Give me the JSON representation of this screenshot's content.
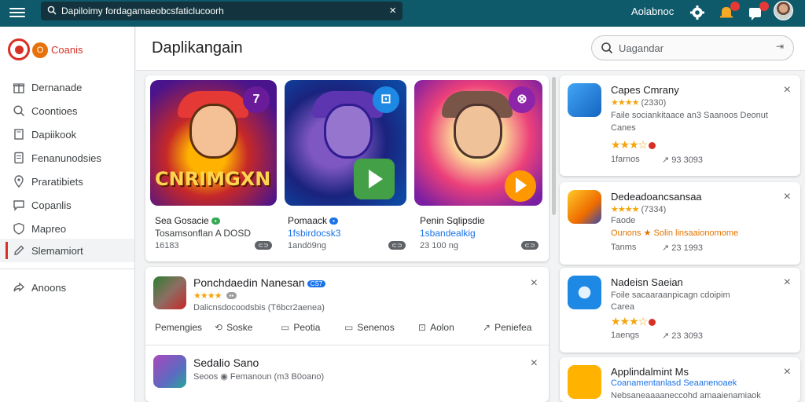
{
  "topbar": {
    "url": "Dapiloimy fordagamaeobcsfaticlucoorh",
    "user_name": "Aolabnoc"
  },
  "sidebar": {
    "brand": "Coanis",
    "brand_logo_glyph": "O",
    "items": [
      {
        "label": "Dernanade",
        "icon": "gift-icon"
      },
      {
        "label": "Coontioes",
        "icon": "search-icon"
      },
      {
        "label": "Dapiikook",
        "icon": "book-icon"
      },
      {
        "label": "Fenanunodsies",
        "icon": "document-icon"
      },
      {
        "label": "Praratibiets",
        "icon": "location-pin-icon"
      },
      {
        "label": "Copanlis",
        "icon": "chat-icon"
      },
      {
        "label": "Mapreo",
        "icon": "shield-icon"
      },
      {
        "label": "Slemamiort",
        "icon": "edit-icon",
        "active": true
      },
      {
        "label": "Anoons",
        "icon": "share-icon"
      }
    ]
  },
  "header": {
    "title": "Daplikangain",
    "search_placeholder": "Uagandar"
  },
  "featured": [
    {
      "art_text": "CNRIMGXN",
      "badge": "7",
      "name": "Sea Gosacie",
      "tag": "▪",
      "subtitle": "Tosamsonflan A DOSD",
      "meta": "16183",
      "download": "⊂⊃"
    },
    {
      "badge": "⊡",
      "name": "Pomaack",
      "tag": "▪",
      "subtitle": "1fsbirdocsk3",
      "meta": "1andö9ng",
      "download": "⊂⊃"
    },
    {
      "badge": "⊗",
      "name": "Penin Sqlipsdie",
      "subtitle": "1sbandealkig",
      "meta": "23 100 ng",
      "download": "⊂⊃"
    }
  ],
  "list": [
    {
      "name": "Ponchdaedin Nanesan",
      "tag": "CS7",
      "stars": "★★★★",
      "rating_box": "▪▪",
      "meta": "Dalicnsdocoodsbis (T6bcr2aenea)"
    },
    {
      "name": "Sedalio Sano",
      "meta": "Seoos ◉ Femanoun (m3 B0oano)"
    }
  ],
  "actions": [
    {
      "label": "Pemengies",
      "icon": ""
    },
    {
      "label": "Soske",
      "icon": "⟲"
    },
    {
      "label": "Peotia",
      "icon": "▭"
    },
    {
      "label": "Senenos",
      "icon": "▭"
    },
    {
      "label": "Aolon",
      "icon": "⊡"
    },
    {
      "label": "Peniefea",
      "icon": "↗"
    }
  ],
  "right_cards": [
    {
      "title": "Capes Cmrany",
      "stars_small": "★★★★",
      "count": "(2330)",
      "line2": "Faile sociankitaace an3 Saanoos Deonut",
      "line3": "Canes",
      "stars": "★★★☆",
      "footer_left": "1farnos",
      "footer_right": "93 3093"
    },
    {
      "title": "Dedeadoancsansaa",
      "stars_small": "★★★★",
      "count": "(7334)",
      "line2": "Faode",
      "line3": "Ounons ★ Solin linsaaionomome",
      "footer_left": "Tanms",
      "footer_right": "23 1993"
    },
    {
      "title": "Nadeisn Saeian",
      "line2": "Foile sacaaraanpicagn cdoipim",
      "line3": "Carea",
      "stars": "★★★☆",
      "footer_left": "1aengs",
      "footer_right": "23 3093"
    },
    {
      "title": "Applindalmint Ms",
      "line2": "Coanamentanlasd Seaanenoaek",
      "line3": "Nebsaneaaaaneccohd amaaienamiaok"
    }
  ],
  "colors": {
    "topbar": "#0e5a6b",
    "brand": "#d93025",
    "star": "#f4a50b",
    "link": "#1a73e8"
  }
}
